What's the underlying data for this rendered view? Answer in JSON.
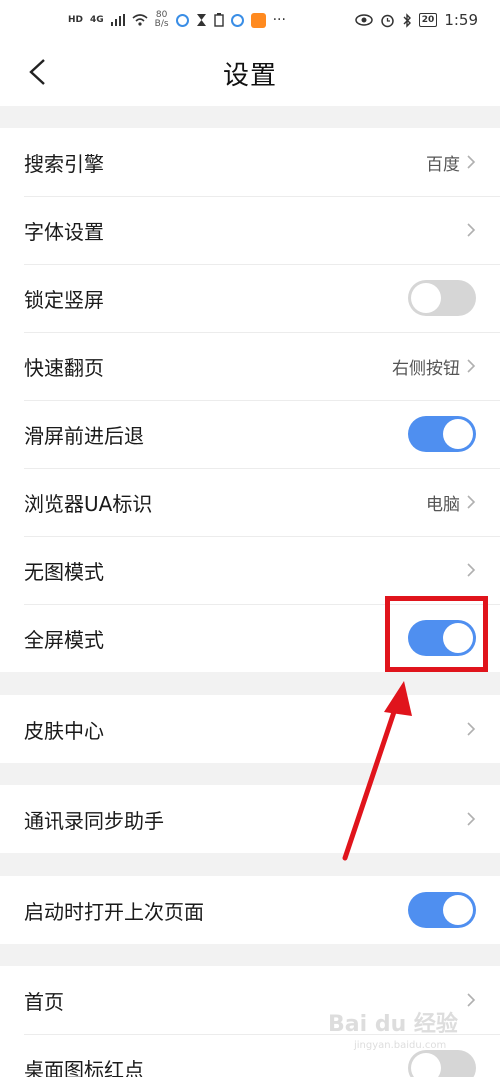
{
  "status_bar": {
    "left_hd": "HD",
    "left_net": "4G",
    "speed_top": "80",
    "speed_bottom": "B/s",
    "battery": "20",
    "time": "1:59",
    "more": "···"
  },
  "header": {
    "title": "设置",
    "back_icon": "chevron-left-icon"
  },
  "groups": [
    {
      "rows": [
        {
          "label": "搜索引擎",
          "value": "百度",
          "control": "chevron"
        },
        {
          "label": "字体设置",
          "value": "",
          "control": "chevron"
        },
        {
          "label": "锁定竖屏",
          "control": "toggle",
          "on": false
        },
        {
          "label": "快速翻页",
          "value": "右侧按钮",
          "control": "chevron"
        },
        {
          "label": "滑屏前进后退",
          "control": "toggle",
          "on": true
        },
        {
          "label": "浏览器UA标识",
          "value": "电脑",
          "control": "chevron"
        },
        {
          "label": "无图模式",
          "value": "",
          "control": "chevron"
        },
        {
          "label": "全屏模式",
          "control": "toggle",
          "on": true
        }
      ]
    },
    {
      "rows": [
        {
          "label": "皮肤中心",
          "value": "",
          "control": "chevron"
        }
      ]
    },
    {
      "rows": [
        {
          "label": "通讯录同步助手",
          "value": "",
          "control": "chevron"
        }
      ]
    },
    {
      "rows": [
        {
          "label": "启动时打开上次页面",
          "control": "toggle",
          "on": true
        }
      ]
    },
    {
      "rows": [
        {
          "label": "首页",
          "value": "",
          "control": "chevron"
        },
        {
          "label": "桌面图标红点",
          "control": "toggle",
          "on": false
        }
      ]
    }
  ],
  "colors": {
    "toggle_on": "#4f8ff0",
    "toggle_off": "#d6d6d6",
    "annotation": "#e0141c"
  },
  "watermark": {
    "text": "Bai du 经验",
    "sub": "jingyan.baidu.com"
  }
}
